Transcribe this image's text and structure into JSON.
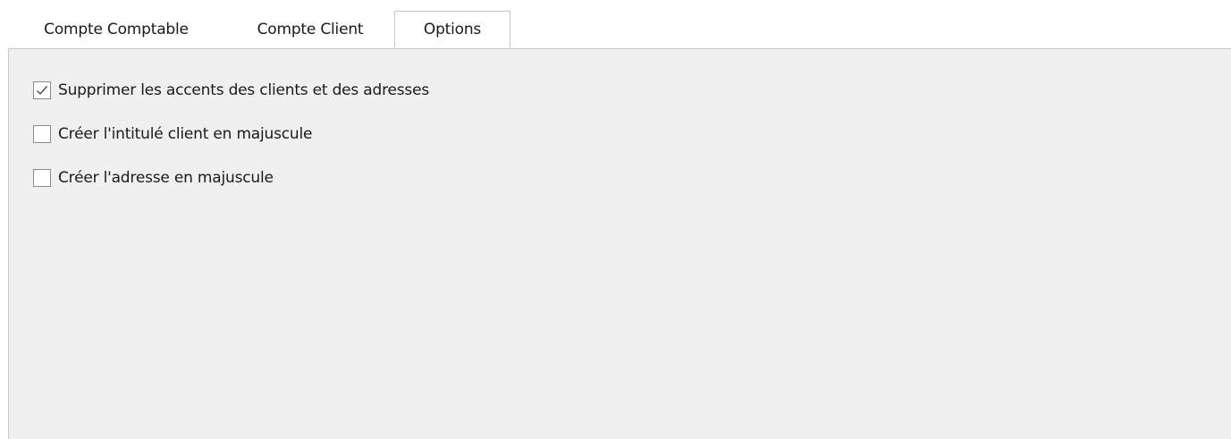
{
  "tabs": [
    {
      "label": "Compte Comptable",
      "active": false
    },
    {
      "label": "Compte Client",
      "active": false
    },
    {
      "label": "Options",
      "active": true
    }
  ],
  "options": [
    {
      "label": "Supprimer les accents des clients et des adresses",
      "checked": true,
      "icon": "checkmark-icon"
    },
    {
      "label": "Créer l'intitulé client en majuscule",
      "checked": false
    },
    {
      "label": "Créer l'adresse en majuscule",
      "checked": false
    }
  ],
  "colors": {
    "panel_background": "#f0f0f0",
    "border": "#c8c8c8",
    "checkmark": "#4a4a4a"
  }
}
